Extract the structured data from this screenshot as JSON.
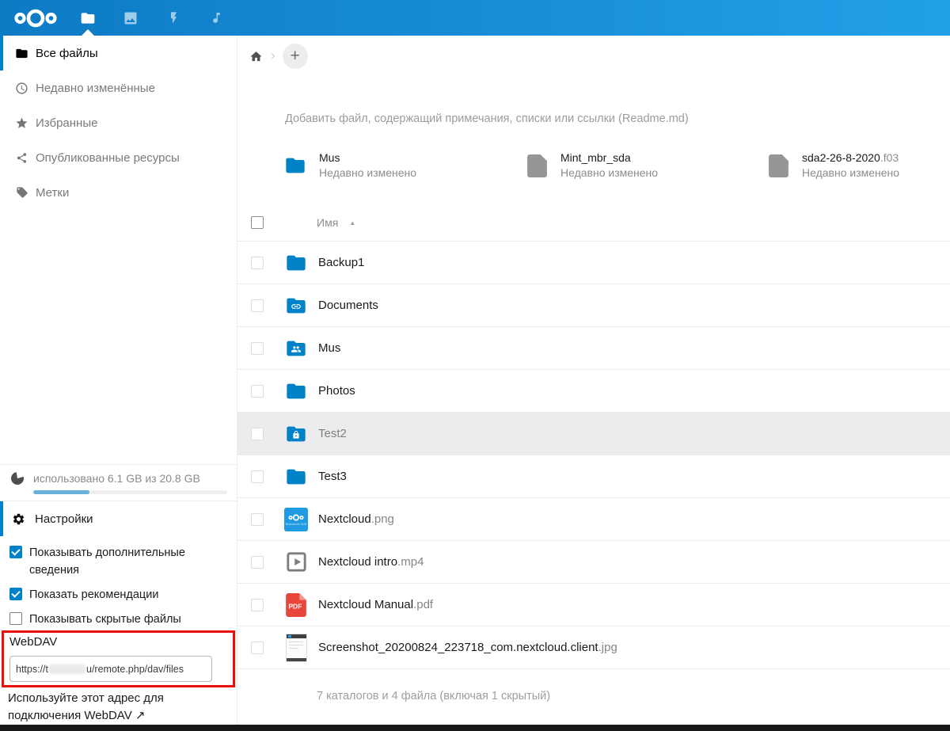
{
  "colors": {
    "accent": "#0082c9",
    "topbar_from": "#0d7ac4",
    "topbar_to": "#21a0e8",
    "folder": "#0082c9",
    "annotation_red": "#e81109",
    "highlight_row": "#ececec"
  },
  "topbar": {
    "apps": [
      {
        "id": "files",
        "active": true
      },
      {
        "id": "photos",
        "active": false
      },
      {
        "id": "activity",
        "active": false
      },
      {
        "id": "music",
        "active": false
      }
    ]
  },
  "sidebar": {
    "items": [
      {
        "id": "all-files",
        "label": "Все файлы",
        "icon": "folder",
        "active": true
      },
      {
        "id": "recent",
        "label": "Недавно изменённые",
        "icon": "clock",
        "active": false
      },
      {
        "id": "favorites",
        "label": "Избранные",
        "icon": "star",
        "active": false
      },
      {
        "id": "shares",
        "label": "Опубликованные ресурсы",
        "icon": "share",
        "active": false
      },
      {
        "id": "tags",
        "label": "Метки",
        "icon": "tag",
        "active": false
      }
    ],
    "storage": {
      "label": "использовано 6.1 GB из 20.8 GB",
      "percent": 29
    },
    "settings_label": "Настройки",
    "options": [
      {
        "id": "show-details",
        "label": "Показывать дополнительные сведения",
        "checked": true
      },
      {
        "id": "show-recommendations",
        "label": "Показать рекомендации",
        "checked": true
      },
      {
        "id": "show-hidden",
        "label": "Показывать скрытые файлы",
        "checked": false
      }
    ],
    "webdav": {
      "label": "WebDAV",
      "url_prefix": "https://t",
      "url_censored": true,
      "url_suffix": "u/remote.php/dav/files",
      "hint": "Используйте этот адрес для подключения WebDAV",
      "hint_arrow": "↗"
    }
  },
  "main": {
    "breadcrumb": {
      "separator": "›",
      "add_label": "+"
    },
    "readme_hint": "Добавить файл, содержащий примечания, списки или ссылки (Readme.md)",
    "recommendations": [
      {
        "name": "Mus",
        "ext": "",
        "subtitle": "Недавно изменено",
        "icon": "folder"
      },
      {
        "name": "Mint_mbr_sda",
        "ext": "",
        "subtitle": "Недавно изменено",
        "icon": "file"
      },
      {
        "name": "sda2-26-8-2020",
        "ext": ".f03",
        "subtitle": "Недавно изменено",
        "icon": "file"
      }
    ],
    "nextcloud_thumb_text": "Nextcloud HUB",
    "pdf_badge_text": "PDF",
    "table": {
      "name_header": "Имя",
      "sort_glyph": "▲",
      "rows": [
        {
          "name": "Backup1",
          "ext": "",
          "icon": "folder",
          "highlighted": false
        },
        {
          "name": "Documents",
          "ext": "",
          "icon": "folder-link",
          "highlighted": false
        },
        {
          "name": "Mus",
          "ext": "",
          "icon": "folder-shared",
          "highlighted": false
        },
        {
          "name": "Photos",
          "ext": "",
          "icon": "folder",
          "highlighted": false
        },
        {
          "name": "Test2",
          "ext": "",
          "icon": "folder-lock",
          "highlighted": true
        },
        {
          "name": "Test3",
          "ext": "",
          "icon": "folder",
          "highlighted": false
        },
        {
          "name": "Nextcloud",
          "ext": ".png",
          "icon": "nextcloud-thumb",
          "highlighted": false
        },
        {
          "name": "Nextcloud intro",
          "ext": ".mp4",
          "icon": "video",
          "highlighted": false
        },
        {
          "name": "Nextcloud Manual",
          "ext": ".pdf",
          "icon": "pdf",
          "highlighted": false
        },
        {
          "name": "Screenshot_20200824_223718_com.nextcloud.client",
          "ext": ".jpg",
          "icon": "screenshot-thumb",
          "highlighted": false
        }
      ],
      "summary": "7 каталогов и 4 файла (включая 1 скрытый)"
    }
  }
}
